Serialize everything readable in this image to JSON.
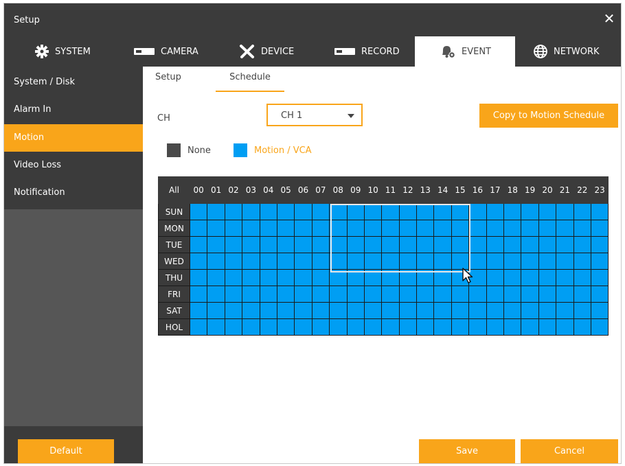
{
  "window": {
    "title": "Setup",
    "close_icon": "close-icon"
  },
  "tabs": [
    {
      "label": "SYSTEM",
      "icon": "gear-icon"
    },
    {
      "label": "CAMERA",
      "icon": "camera-icon"
    },
    {
      "label": "DEVICE",
      "icon": "tools-icon"
    },
    {
      "label": "RECORD",
      "icon": "recorder-icon"
    },
    {
      "label": "EVENT",
      "icon": "bell-icon",
      "active": true
    },
    {
      "label": "NETWORK",
      "icon": "globe-icon"
    }
  ],
  "sidebar": {
    "items": [
      {
        "label": "System / Disk"
      },
      {
        "label": "Alarm In"
      },
      {
        "label": "Motion",
        "active": true
      },
      {
        "label": "Video Loss"
      },
      {
        "label": "Notification"
      }
    ]
  },
  "subtabs": [
    {
      "label": "Setup"
    },
    {
      "label": "Schedule",
      "active": true
    }
  ],
  "channel": {
    "label": "CH",
    "value": "CH 1"
  },
  "copy_button": "Copy to Motion Schedule",
  "legend": {
    "none": {
      "label": "None",
      "color": "#4a4a4a"
    },
    "motion": {
      "label": "Motion / VCA",
      "color": "#009ef3"
    }
  },
  "schedule": {
    "all_label": "All",
    "hours": [
      "00",
      "01",
      "02",
      "03",
      "04",
      "05",
      "06",
      "07",
      "08",
      "09",
      "10",
      "11",
      "12",
      "13",
      "14",
      "15",
      "16",
      "17",
      "18",
      "19",
      "20",
      "21",
      "22",
      "23"
    ],
    "days": [
      "SUN",
      "MON",
      "TUE",
      "WED",
      "THU",
      "FRI",
      "SAT",
      "HOL"
    ],
    "cell_state": "Motion / VCA"
  },
  "buttons": {
    "default": "Default",
    "save": "Save",
    "cancel": "Cancel"
  },
  "colors": {
    "accent": "#f9a51a",
    "dark": "#3b3b3b",
    "cell": "#009ef3"
  }
}
